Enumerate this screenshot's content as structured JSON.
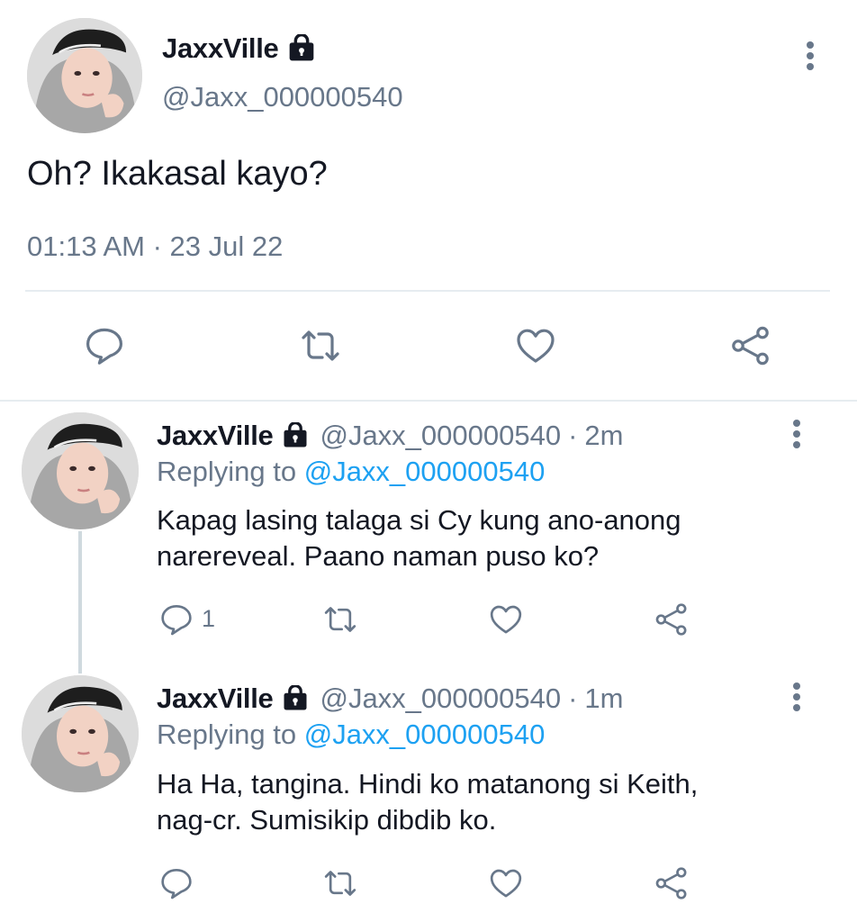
{
  "tweet": {
    "display_name": "JaxxVille",
    "handle": "@Jaxx_000000540",
    "text": "Oh? Ikakasal kayo?",
    "timestamp": "01:13 AM · 23 Jul 22",
    "icons": [
      "reply-icon",
      "retweet-icon",
      "like-icon",
      "share-icon",
      "lock-icon",
      "more-icon"
    ]
  },
  "replies": [
    {
      "display_name": "JaxxVille",
      "handle": "@Jaxx_000000540",
      "separator": "·",
      "time": "2m",
      "replying_prefix": "Replying to ",
      "replying_to": "@Jaxx_000000540",
      "text_line1": "Kapag lasing talaga si Cy kung ano-anong",
      "text_line2": "narereveal. Paano naman puso ko?",
      "reply_count": "1"
    },
    {
      "display_name": "JaxxVille",
      "handle": "@Jaxx_000000540",
      "separator": "·",
      "time": "1m",
      "replying_prefix": "Replying to ",
      "replying_to": "@Jaxx_000000540",
      "text_line1": "Ha Ha, tangina. Hindi ko matanong si Keith,",
      "text_line2": "nag-cr. Sumisikip dibdib ko.",
      "reply_count": ""
    }
  ],
  "colors": {
    "text": "#141823",
    "secondary": "#68778a",
    "mention": "#1da1f2",
    "divider": "#e6ecf0"
  }
}
